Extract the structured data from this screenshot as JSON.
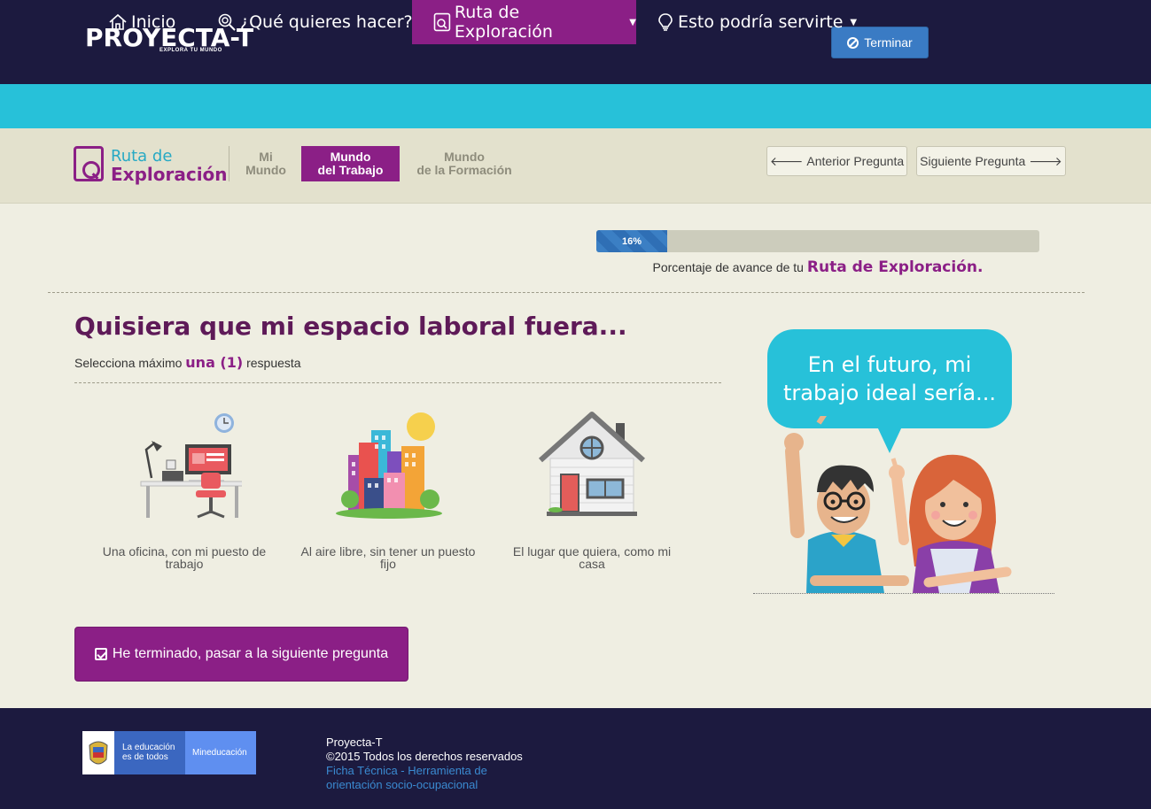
{
  "header": {
    "logo_text": "PROYECTA-T",
    "logo_tagline": "EXPLORA TU MUNDO",
    "terminar_label": "Terminar"
  },
  "nav": {
    "items": [
      {
        "label": "Inicio",
        "icon": "home-icon"
      },
      {
        "label": "¿Qué quieres hacer?",
        "icon": "search-icon"
      },
      {
        "label": "Ruta de Exploración",
        "icon": "route-icon",
        "active": true
      },
      {
        "label": "Esto podría servirte",
        "icon": "lightbulb-icon"
      }
    ]
  },
  "subbar": {
    "ruta_line1": "Ruta de",
    "ruta_line2": "Exploración",
    "stages": [
      {
        "line1": "Mi",
        "line2": "Mundo"
      },
      {
        "line1": "Mundo",
        "line2": "del Trabajo",
        "active": true
      },
      {
        "line1": "Mundo",
        "line2": "de la Formación"
      }
    ],
    "prev_label": "Anterior Pregunta",
    "next_label": "Siguiente Pregunta"
  },
  "progress": {
    "percent": 16,
    "percent_label": "16%",
    "caption_prefix": "Porcentaje de avance de tu",
    "caption_strong": "Ruta de Exploración."
  },
  "question": {
    "title": "Quisiera que mi espacio laboral fuera...",
    "instruction_prefix": "Selecciona máximo",
    "instruction_strong": "una (1)",
    "instruction_suffix": "respuesta",
    "options": [
      {
        "label": "Una oficina, con mi puesto de trabajo",
        "icon": "office-desk-icon"
      },
      {
        "label": "Al aire libre, sin tener un puesto fijo",
        "icon": "city-outdoors-icon"
      },
      {
        "label": "El lugar que quiera, como mi casa",
        "icon": "house-icon"
      }
    ],
    "finish_label": "He terminado, pasar a la siguiente pregunta"
  },
  "illustration": {
    "bubble_text": "En el futuro, mi trabajo ideal sería..."
  },
  "footer": {
    "edu_line1": "La educación",
    "edu_line2": "es de todos",
    "edu_ministry": "Mineducación",
    "line1": "Proyecta-T",
    "line2": "©2015 Todos los derechos reservados",
    "link": "Ficha Técnica - Herramienta de orientación socio-ocupacional"
  },
  "colors": {
    "header_bg": "#1c1a3f",
    "nav_bg": "#27c1d9",
    "accent_purple": "#8b1f86",
    "button_blue": "#3a7bc4",
    "page_bg": "#efeee2"
  }
}
